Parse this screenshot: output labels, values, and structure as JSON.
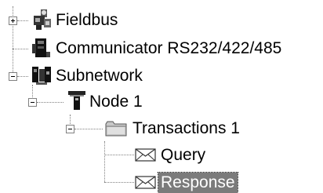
{
  "tree": {
    "nodes": [
      {
        "label": "Fieldbus",
        "icon": "fieldbus-icon",
        "expander": "plus"
      },
      {
        "label": "Communicator RS232/422/485",
        "icon": "communicator-icon",
        "expander": "none"
      },
      {
        "label": "Subnetwork",
        "icon": "subnetwork-icon",
        "expander": "minus"
      },
      {
        "label": "Node 1",
        "icon": "node-icon",
        "expander": "minus"
      },
      {
        "label": "Transactions 1",
        "icon": "folder-icon",
        "expander": "minus"
      },
      {
        "label": "Query",
        "icon": "envelope-icon",
        "expander": "none"
      },
      {
        "label": "Response",
        "icon": "envelope-icon",
        "expander": "none",
        "selected": true
      }
    ],
    "colors": {
      "connector": "#808080",
      "selection_bg": "#7b7b7b",
      "selection_text": "#ffffff"
    }
  }
}
